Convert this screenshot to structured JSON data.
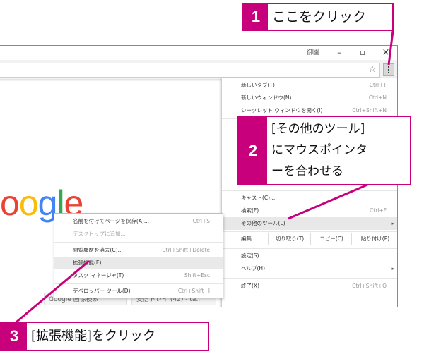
{
  "window": {
    "title_fragment": "御園",
    "minimize": "–",
    "maximize": "▫",
    "close": "×"
  },
  "toolbar": {
    "star": "☆"
  },
  "page": {
    "logo_letters": [
      "o",
      "o",
      "g",
      "l",
      "e"
    ],
    "logo_colors": [
      "#ea4335",
      "#fbbc05",
      "#4285f4",
      "#34a853",
      "#ea4335"
    ],
    "tile1": "Google 画像検索",
    "tile2": "受信トレイ (42) - ta..."
  },
  "menu": {
    "new_tab": {
      "label": "新しいタブ(T)",
      "shortcut": "Ctrl+T"
    },
    "new_window": {
      "label": "新しいウィンドウ(N)",
      "shortcut": "Ctrl+N"
    },
    "incognito": {
      "label": "シークレット ウィンドウを開く(I)",
      "shortcut": "Ctrl+Shift+N"
    },
    "cast": {
      "label": "キャスト(C)..."
    },
    "find": {
      "label": "検索(F)...",
      "shortcut": "Ctrl+F"
    },
    "more_tools": {
      "label": "その他のツール(L)",
      "arrow": "▸"
    },
    "edit": {
      "label": "編集",
      "cut": "切り取り(T)",
      "copy": "コピー(C)",
      "paste": "貼り付け(P)"
    },
    "settings": {
      "label": "設定(S)"
    },
    "help": {
      "label": "ヘルプ(H)",
      "arrow": "▸"
    },
    "exit": {
      "label": "終了(X)",
      "shortcut": "Ctrl+Shift+Q"
    }
  },
  "submenu": {
    "save_page": {
      "label": "名前を付けてページを保存(A)...",
      "shortcut": "Ctrl+S"
    },
    "add_desktop": {
      "label": "デスクトップに追加..."
    },
    "clear_data": {
      "label": "閲覧履歴を消去(C)...",
      "shortcut": "Ctrl+Shift+Delete"
    },
    "extensions": {
      "label": "拡張機能(E)"
    },
    "task_manager": {
      "label": "タスク マネージャ(T)",
      "shortcut": "Shift+Esc"
    },
    "devtools": {
      "label": "デベロッパー ツール(D)",
      "shortcut": "Ctrl+Shift+I"
    }
  },
  "callouts": {
    "c1": {
      "num": "1",
      "text": "ここをクリック"
    },
    "c2": {
      "num": "2",
      "line1": "[その他のツール]",
      "line2": "にマウスポインタ",
      "line3": "ーを合わせる"
    },
    "c3": {
      "num": "3",
      "text": "[拡張機能]をクリック"
    }
  },
  "colors": {
    "accent": "#c8007b"
  }
}
